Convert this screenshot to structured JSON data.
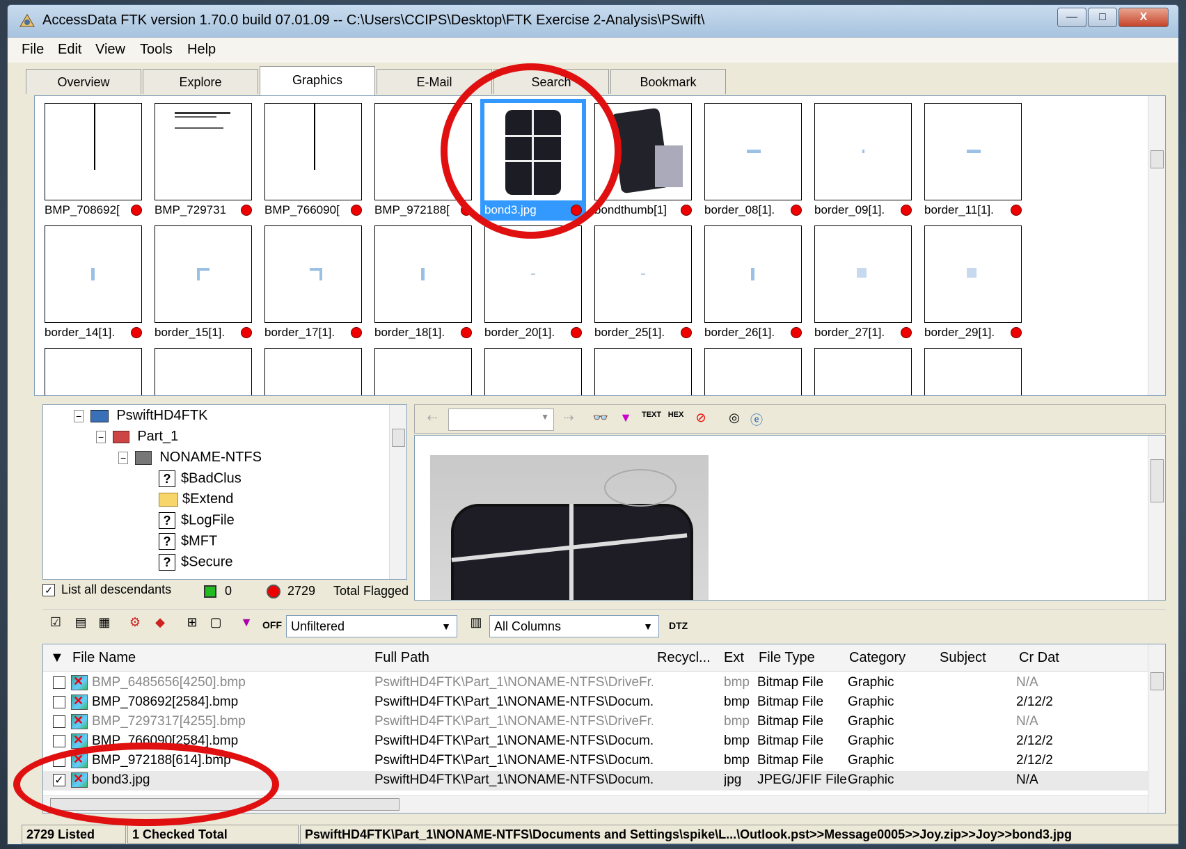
{
  "window": {
    "title": "AccessData FTK version 1.70.0 build 07.01.09 -- C:\\Users\\CCIPS\\Desktop\\FTK Exercise 2-Analysis\\PSwift\\",
    "controls": [
      "—",
      "□",
      "X"
    ]
  },
  "menu": [
    "File",
    "Edit",
    "View",
    "Tools",
    "Help"
  ],
  "tabs": [
    {
      "label": "Overview"
    },
    {
      "label": "Explore"
    },
    {
      "label": "Graphics",
      "active": true
    },
    {
      "label": "E-Mail"
    },
    {
      "label": "Search"
    },
    {
      "label": "Bookmark"
    }
  ],
  "gallery": {
    "row1": [
      "BMP_708692[",
      "BMP_729731",
      "BMP_766090[",
      "BMP_972188[",
      "bond3.jpg",
      "bondthumb[1]",
      "border_08[1].",
      "border_09[1].",
      "border_11[1]."
    ],
    "row2": [
      "border_14[1].",
      "border_15[1].",
      "border_17[1].",
      "border_18[1].",
      "border_20[1].",
      "border_25[1].",
      "border_26[1].",
      "border_27[1].",
      "border_29[1]."
    ],
    "selected": "bond3.jpg"
  },
  "tree": {
    "root": "PswiftHD4FTK",
    "partition": "Part_1",
    "volume": "NONAME-NTFS",
    "items": [
      "$BadClus",
      "$Extend",
      "$LogFile",
      "$MFT",
      "$Secure"
    ]
  },
  "counts": {
    "list_all_descendants": "List all descendants",
    "checked_count": "0",
    "flagged_count": "2729",
    "flagged_label": "Total Flagged"
  },
  "list_toolbar": {
    "off_label": "OFF",
    "filter": "Unfiltered",
    "columns": "All Columns",
    "dtz": "DTZ"
  },
  "columns": [
    "File Name",
    "Full Path",
    "Recycl...",
    "Ext",
    "File Type",
    "Category",
    "Subject",
    "Cr Dat"
  ],
  "files": [
    {
      "name": "BMP_6485656[4250].bmp",
      "path": "PswiftHD4FTK\\Part_1\\NONAME-NTFS\\DriveFr...",
      "ext": "bmp",
      "type": "Bitmap File",
      "category": "Graphic",
      "cr": "N/A",
      "checked": false,
      "deleted": true
    },
    {
      "name": "BMP_708692[2584].bmp",
      "path": "PswiftHD4FTK\\Part_1\\NONAME-NTFS\\Docum...",
      "ext": "bmp",
      "type": "Bitmap File",
      "category": "Graphic",
      "cr": "2/12/2",
      "checked": false,
      "deleted": false
    },
    {
      "name": "BMP_7297317[4255].bmp",
      "path": "PswiftHD4FTK\\Part_1\\NONAME-NTFS\\DriveFr...",
      "ext": "bmp",
      "type": "Bitmap File",
      "category": "Graphic",
      "cr": "N/A",
      "checked": false,
      "deleted": true
    },
    {
      "name": "BMP_766090[2584].bmp",
      "path": "PswiftHD4FTK\\Part_1\\NONAME-NTFS\\Docum...",
      "ext": "bmp",
      "type": "Bitmap File",
      "category": "Graphic",
      "cr": "2/12/2",
      "checked": false,
      "deleted": false
    },
    {
      "name": "BMP_972188[614].bmp",
      "path": "PswiftHD4FTK\\Part_1\\NONAME-NTFS\\Docum...",
      "ext": "bmp",
      "type": "Bitmap File",
      "category": "Graphic",
      "cr": "2/12/2",
      "checked": false,
      "deleted": false
    },
    {
      "name": "bond3.jpg",
      "path": "PswiftHD4FTK\\Part_1\\NONAME-NTFS\\Docum...",
      "ext": "jpg",
      "type": "JPEG/JFIF File",
      "category": "Graphic",
      "cr": "N/A",
      "checked": true,
      "deleted": false
    }
  ],
  "status": {
    "listed": "2729 Listed",
    "checked": "1 Checked Total",
    "path": "PswiftHD4FTK\\Part_1\\NONAME-NTFS\\Documents and Settings\\spike\\L...\\Outlook.pst>>Message0005>>Joy.zip>>Joy>>bond3.jpg"
  },
  "colors": {
    "highlight": "#3399ff",
    "flag": "#e00000",
    "annotation": "#e01010"
  }
}
